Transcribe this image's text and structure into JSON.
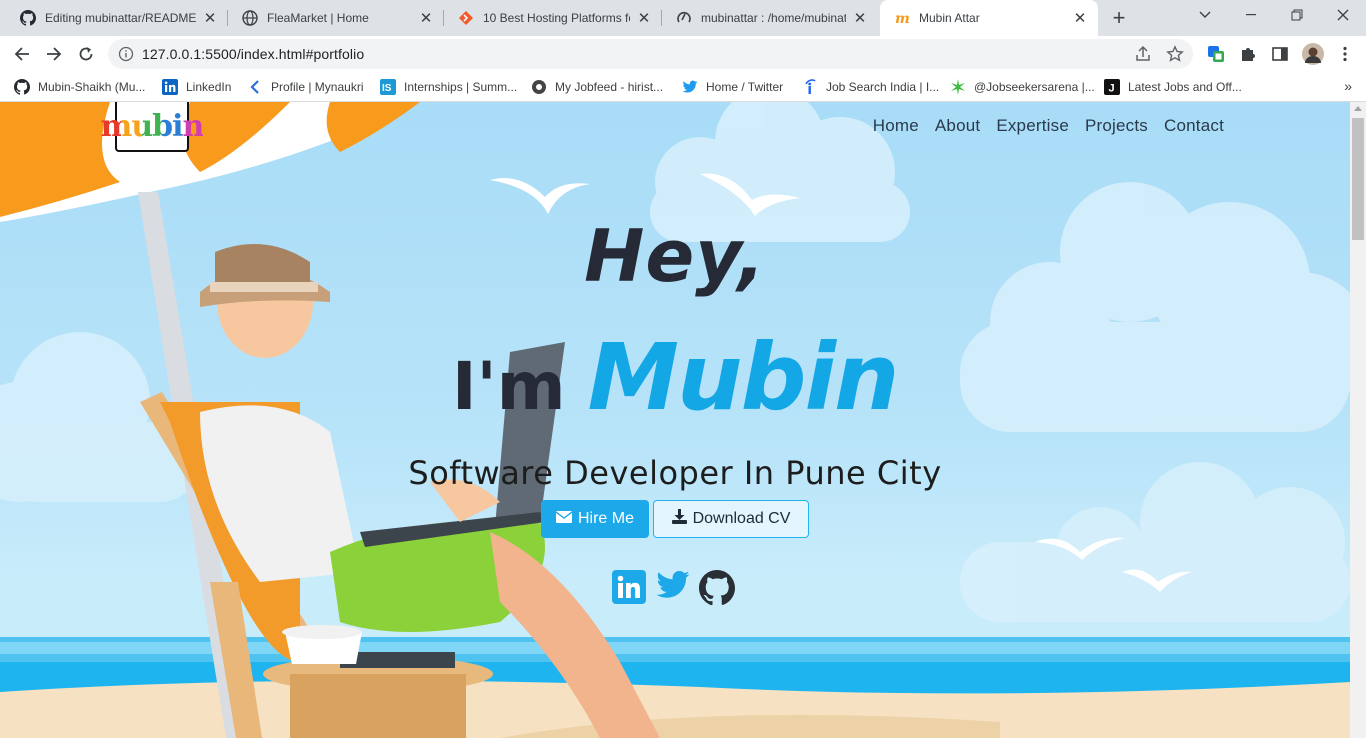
{
  "browser": {
    "tabs": [
      {
        "title": "Editing mubinattar/README.md",
        "icon": "github-icon"
      },
      {
        "title": "FleaMarket | Home",
        "icon": "globe-icon"
      },
      {
        "title": "10 Best Hosting Platforms for",
        "icon": "hosting-icon"
      },
      {
        "title": "mubinattar : /home/mubinattar",
        "icon": "pythonanywhere-icon"
      },
      {
        "title": "Mubin Attar",
        "icon": "m-icon",
        "active": true
      }
    ],
    "url": "127.0.0.1:5500/index.html#portfolio",
    "bookmarks": [
      {
        "label": "Mubin-Shaikh (Mu...",
        "icon": "github-icon"
      },
      {
        "label": "LinkedIn",
        "icon": "linkedin-icon"
      },
      {
        "label": "Profile | Mynaukri",
        "icon": "naukri-icon"
      },
      {
        "label": "Internships | Summ...",
        "icon": "internshala-icon"
      },
      {
        "label": "My Jobfeed - hirist...",
        "icon": "hirist-icon"
      },
      {
        "label": "Home / Twitter",
        "icon": "twitter-icon"
      },
      {
        "label": "Job Search India | I...",
        "icon": "indeed-icon"
      },
      {
        "label": "@Jobseekersarena |...",
        "icon": "star-icon"
      },
      {
        "label": "Latest Jobs and Off...",
        "icon": "j-icon"
      }
    ]
  },
  "site": {
    "logo_text": "mubin",
    "nav": [
      "Home",
      "About",
      "Expertise",
      "Projects",
      "Contact"
    ],
    "hero": {
      "greeting": "Hey,",
      "im": "I'm",
      "name": "Mubin",
      "subtitle": "Software Developer In Pune City"
    },
    "buttons": {
      "hire": "Hire Me",
      "cv": "Download CV"
    },
    "social": [
      "linkedin-icon",
      "twitter-icon",
      "github-icon"
    ],
    "colors": {
      "accent": "#1ca8e9",
      "heading": "#262a36"
    }
  }
}
